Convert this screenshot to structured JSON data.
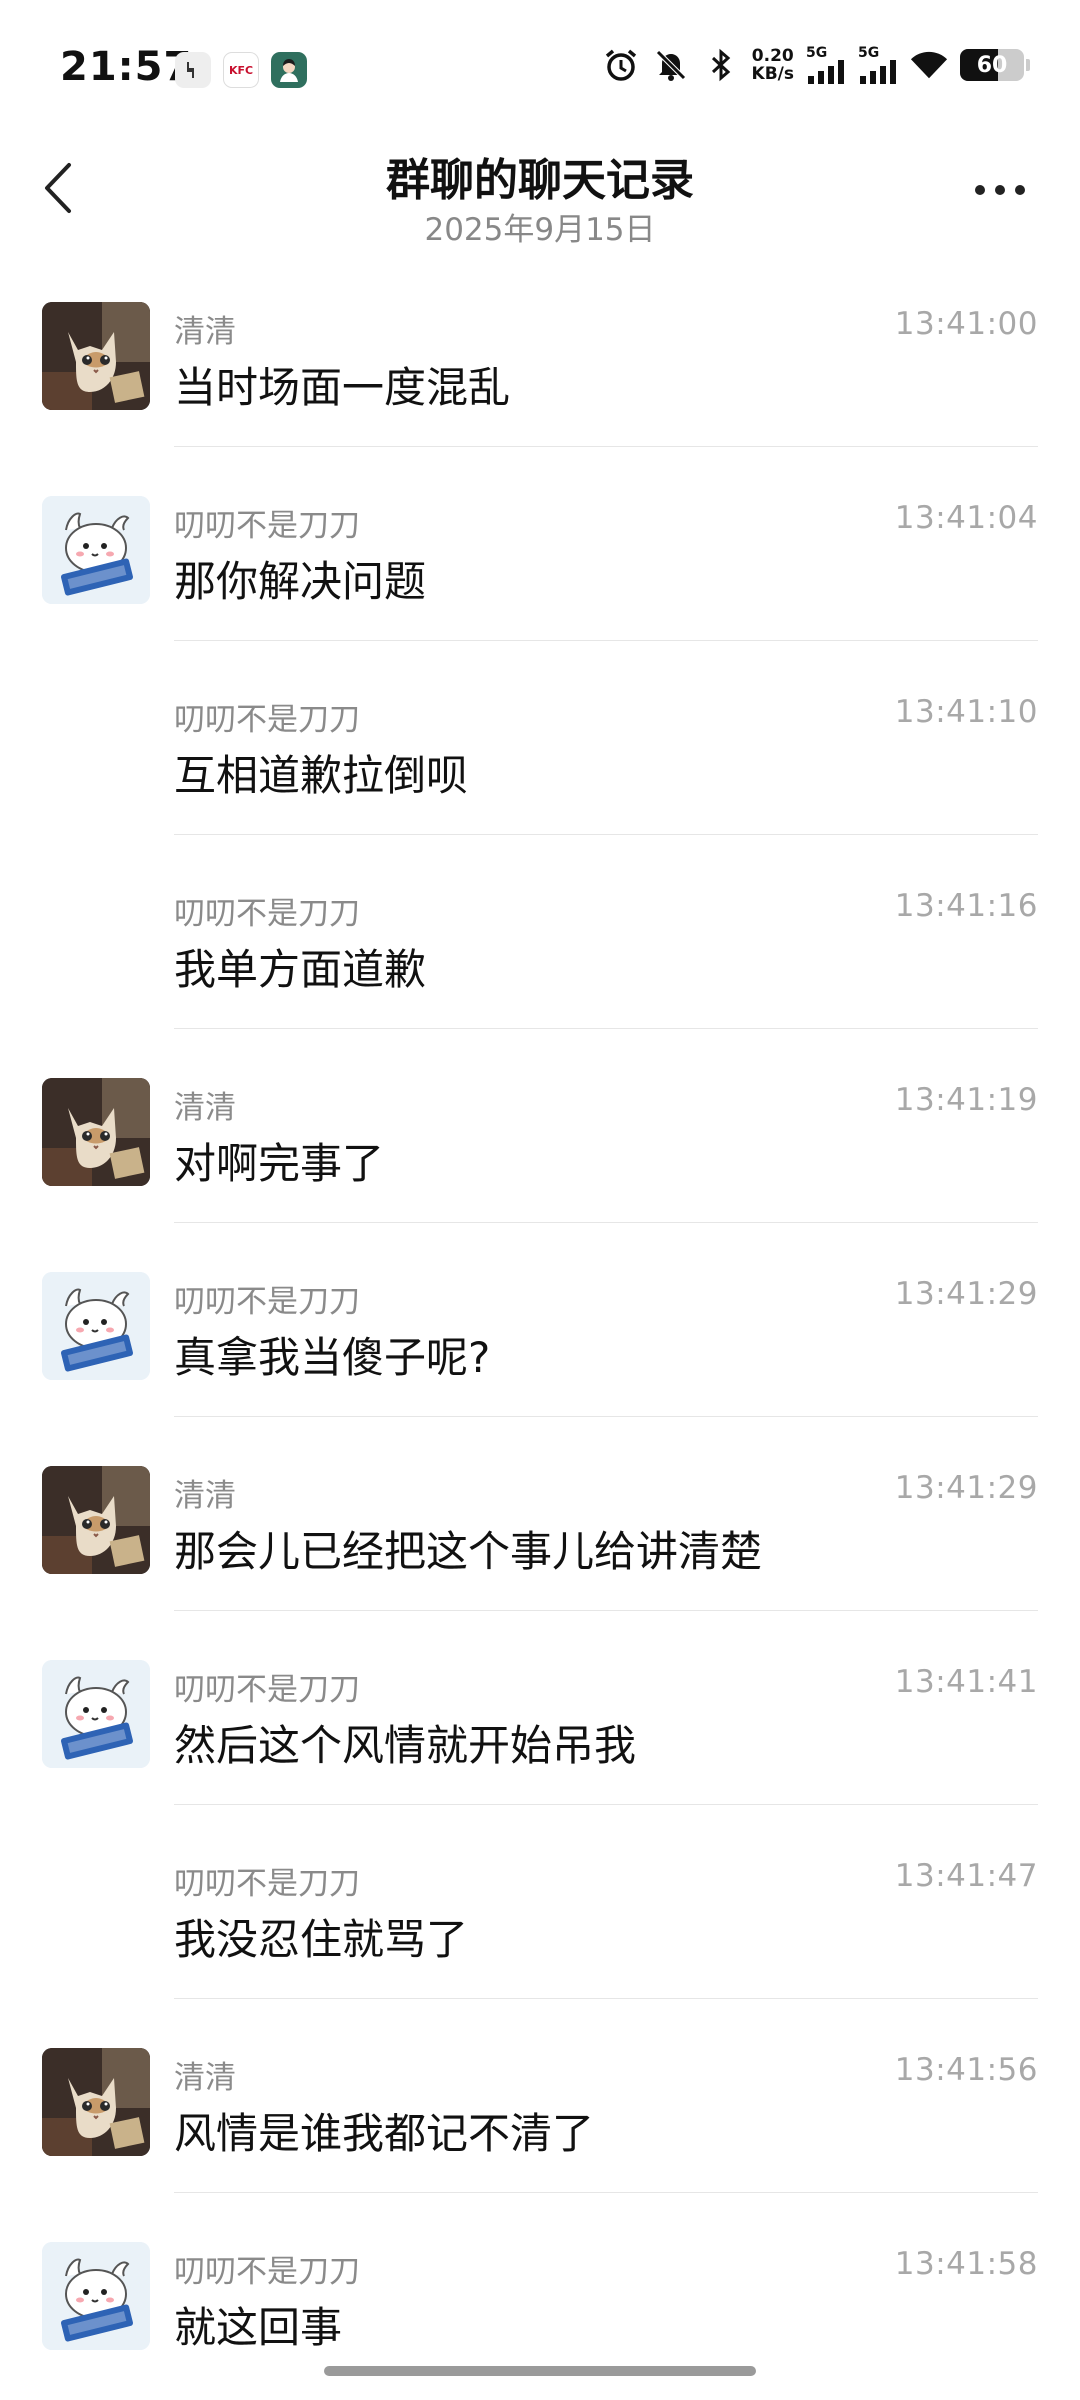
{
  "status_bar": {
    "time": "21:57",
    "net_speed_value": "0.20",
    "net_speed_unit": "KB/s",
    "sim1_label": "5G",
    "sim2_label": "5G",
    "battery": "60",
    "battery_level": 0.6,
    "app_icons": [
      "launcher-icon",
      "kfc-icon",
      "avatar-icon"
    ],
    "kfc_text": "KFC"
  },
  "header": {
    "title": "群聊的聊天记录",
    "subtitle": "2025年9月15日"
  },
  "messages": [
    {
      "sender": "清清",
      "time": "13:41:00",
      "text": "当时场面一度混乱",
      "avatar": "cat"
    },
    {
      "sender": "叨叨不是刀刀",
      "time": "13:41:04",
      "text": "那你解决问题",
      "avatar": "bunny"
    },
    {
      "sender": "叨叨不是刀刀",
      "time": "13:41:10",
      "text": "互相道歉拉倒呗",
      "avatar": ""
    },
    {
      "sender": "叨叨不是刀刀",
      "time": "13:41:16",
      "text": "我单方面道歉",
      "avatar": ""
    },
    {
      "sender": "清清",
      "time": "13:41:19",
      "text": "对啊完事了",
      "avatar": "cat"
    },
    {
      "sender": "叨叨不是刀刀",
      "time": "13:41:29",
      "text": "真拿我当傻子呢?",
      "avatar": "bunny"
    },
    {
      "sender": "清清",
      "time": "13:41:29",
      "text": "那会儿已经把这个事儿给讲清楚",
      "avatar": "cat"
    },
    {
      "sender": "叨叨不是刀刀",
      "time": "13:41:41",
      "text": "然后这个风情就开始吊我",
      "avatar": "bunny"
    },
    {
      "sender": "叨叨不是刀刀",
      "time": "13:41:47",
      "text": "我没忍住就骂了",
      "avatar": ""
    },
    {
      "sender": "清清",
      "time": "13:41:56",
      "text": "风情是谁我都记不清了",
      "avatar": "cat"
    },
    {
      "sender": "叨叨不是刀刀",
      "time": "13:41:58",
      "text": "就这回事",
      "avatar": "bunny"
    }
  ]
}
